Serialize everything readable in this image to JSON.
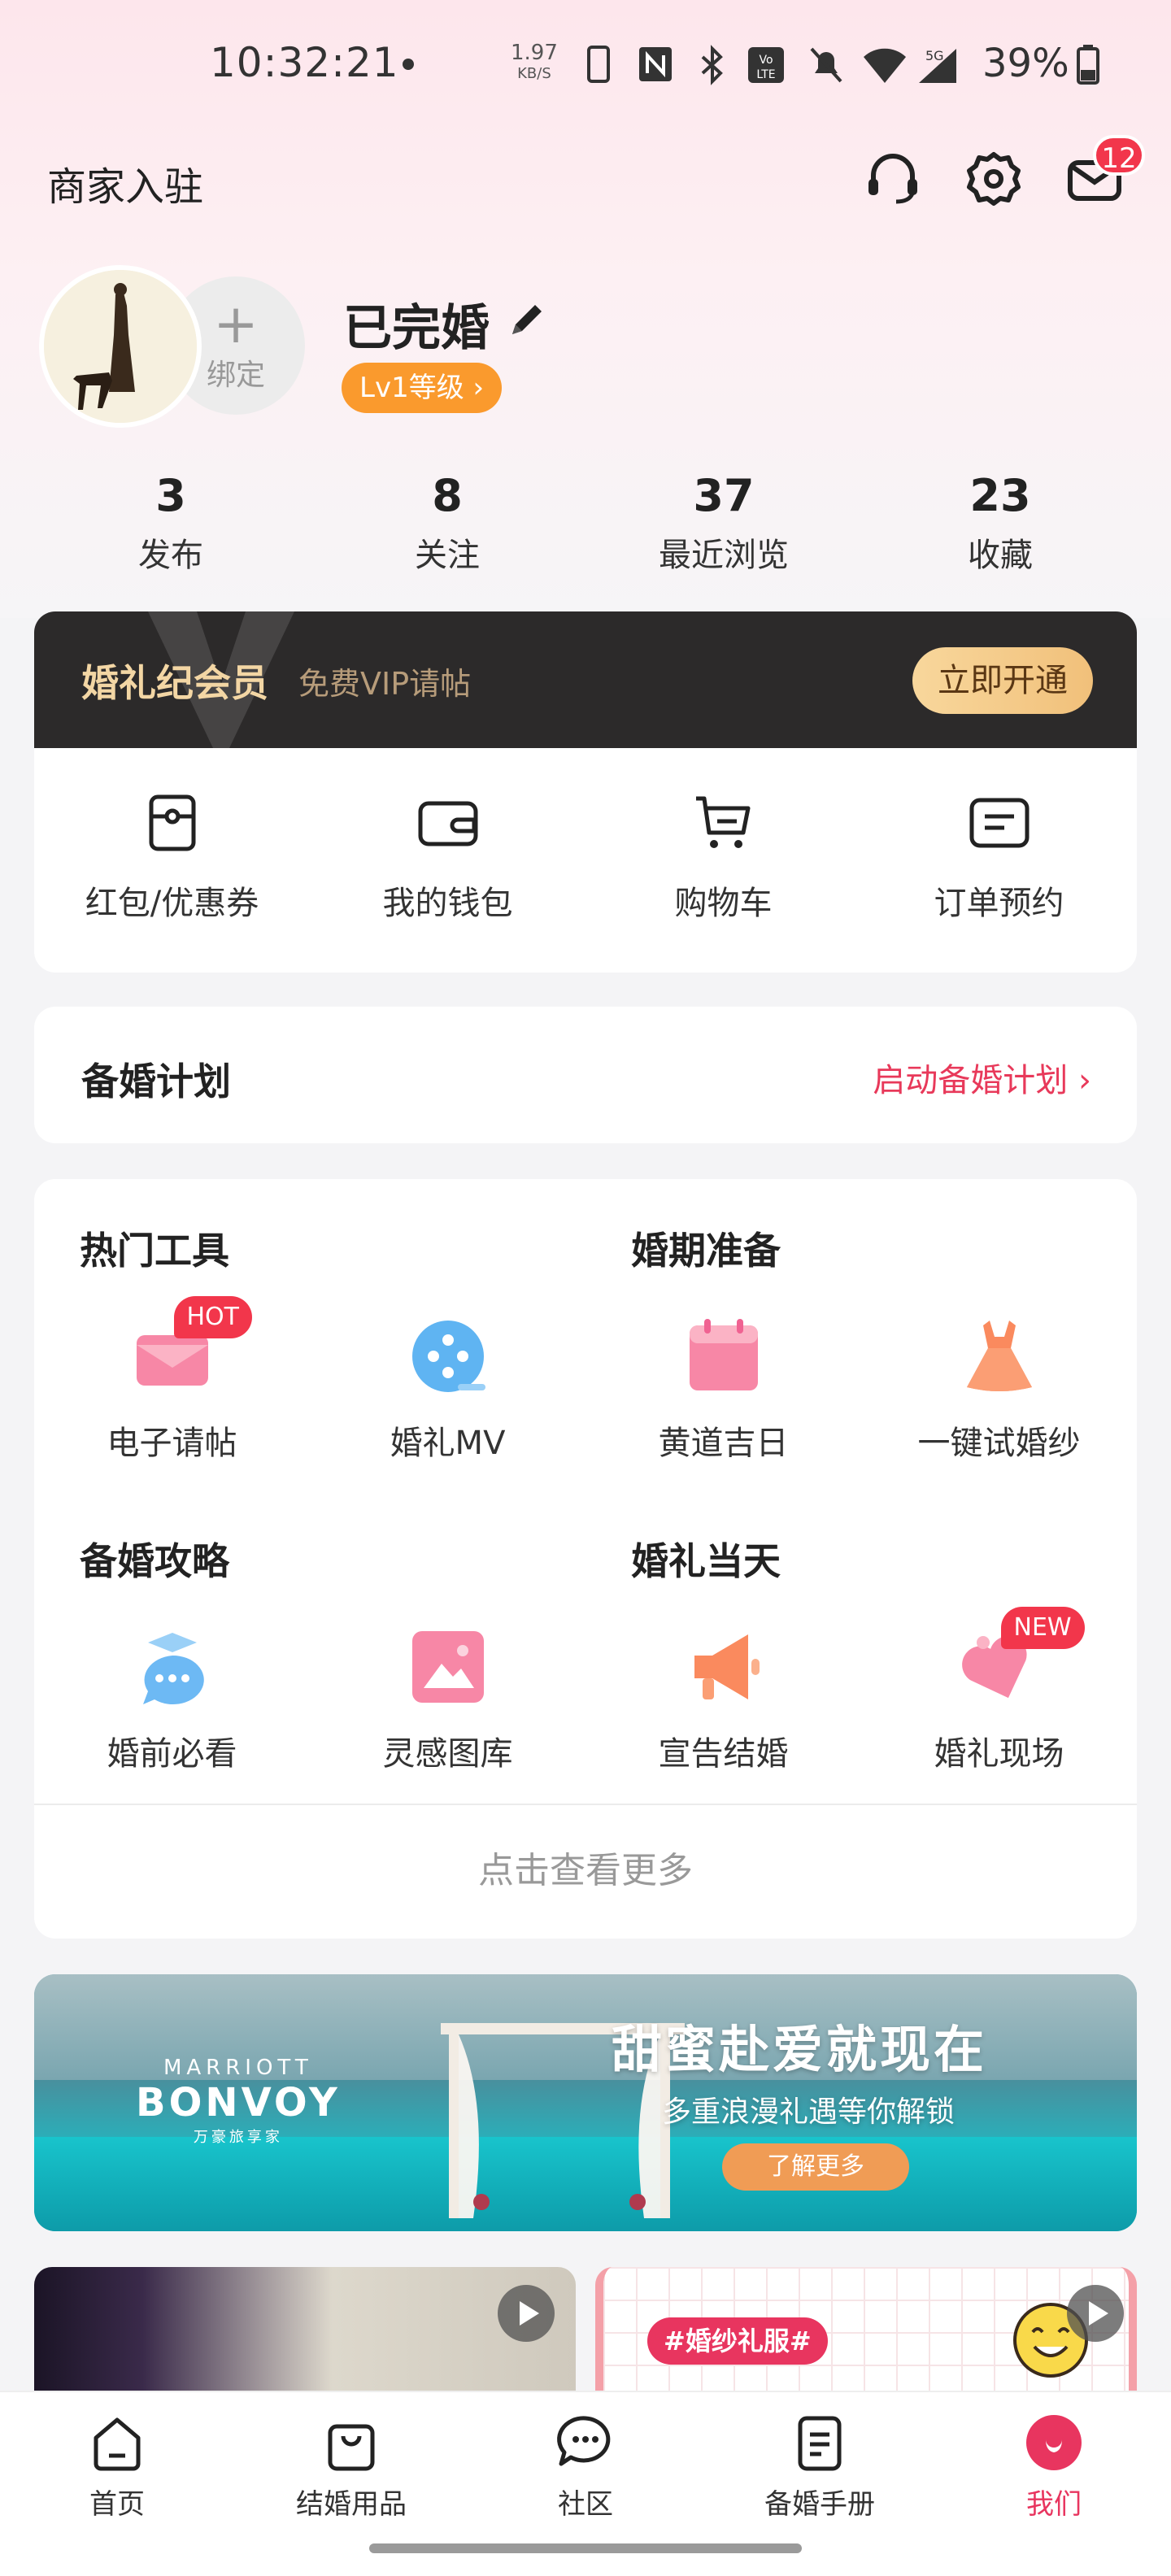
{
  "status_bar": {
    "time": "10:32:21",
    "speed_value": "1.97",
    "speed_unit": "KB/S",
    "battery_percent": "39%"
  },
  "header": {
    "merchant_label": "商家入驻",
    "message_count": "12"
  },
  "profile": {
    "bind_label": "绑定",
    "bind_plus": "+",
    "username": "已完婚",
    "level": "Lv1等级 ›"
  },
  "stats": [
    {
      "value": "3",
      "label": "发布"
    },
    {
      "value": "8",
      "label": "关注"
    },
    {
      "value": "37",
      "label": "最近浏览"
    },
    {
      "value": "23",
      "label": "收藏"
    }
  ],
  "vip": {
    "title": "婚礼纪会员",
    "subtitle": "免费VIP请帖",
    "button": "立即开通"
  },
  "wallet": [
    {
      "label": "红包/优惠券",
      "icon": "coupon-icon"
    },
    {
      "label": "我的钱包",
      "icon": "wallet-icon"
    },
    {
      "label": "购物车",
      "icon": "cart-icon"
    },
    {
      "label": "订单预约",
      "icon": "order-icon"
    }
  ],
  "plan": {
    "title": "备婚计划",
    "action": "启动备婚计划 ›"
  },
  "tools": {
    "sections": {
      "hot": "热门工具",
      "prep": "婚期准备",
      "guide": "备婚攻略",
      "day": "婚礼当天"
    },
    "items": [
      {
        "label": "电子请帖",
        "icon": "invitation-icon",
        "tag": "HOT"
      },
      {
        "label": "婚礼MV",
        "icon": "film-reel-icon"
      },
      {
        "label": "黄道吉日",
        "icon": "calendar-icon"
      },
      {
        "label": "一键试婚纱",
        "icon": "dress-icon"
      },
      {
        "label": "婚前必看",
        "icon": "chat-cap-icon"
      },
      {
        "label": "灵感图库",
        "icon": "gallery-icon"
      },
      {
        "label": "宣告结婚",
        "icon": "megaphone-icon"
      },
      {
        "label": "婚礼现场",
        "icon": "heart-tag-icon",
        "tag": "NEW"
      }
    ],
    "more": "点击查看更多"
  },
  "banner": {
    "brand_line1": "MARRIOTT",
    "brand_line2": "BONVOY",
    "brand_line3": "万豪旅享家",
    "headline": "甜蜜赴爱就现在",
    "subline": "多重浪漫礼遇等你解锁",
    "cta": "了解更多"
  },
  "feed": {
    "right_tag": "#婚纱礼服#"
  },
  "nav": [
    {
      "label": "首页",
      "icon": "home-icon"
    },
    {
      "label": "结婚用品",
      "icon": "shopping-bag-icon"
    },
    {
      "label": "社区",
      "icon": "chat-bubble-icon"
    },
    {
      "label": "备婚手册",
      "icon": "handbook-icon"
    },
    {
      "label": "我们",
      "icon": "us-icon",
      "active": true
    }
  ],
  "colors": {
    "accent": "#e8355f",
    "badge": "#f2364b",
    "vip_bar": "#2c2a2a",
    "level_badge": "#fa9a2d"
  }
}
